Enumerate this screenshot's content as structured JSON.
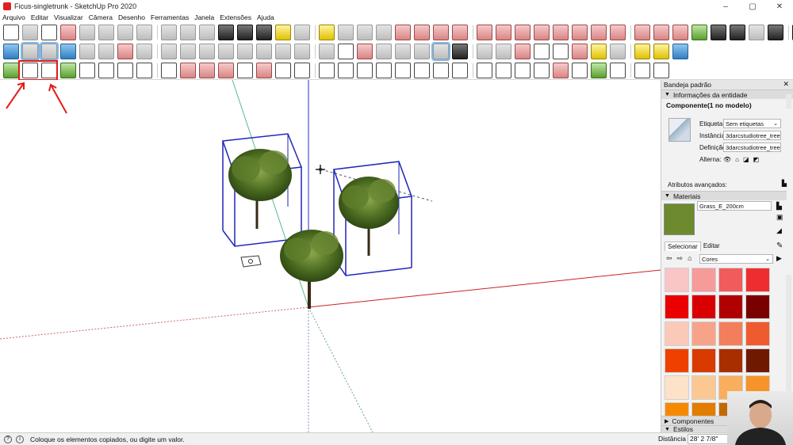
{
  "window": {
    "title": "Ficus-singletrunk - SketchUp Pro 2020",
    "controls": [
      "–",
      "▢",
      "✕"
    ]
  },
  "menu": [
    "Arquivo",
    "Editar",
    "Visualizar",
    "Câmera",
    "Desenho",
    "Ferramentas",
    "Janela",
    "Extensões",
    "Ajuda"
  ],
  "toolbars": {
    "row1": [
      "select-arrow-icon",
      "eraser-icon",
      "paint-bucket-icon",
      "eraser-pink-icon",
      "orbit-icon",
      "pan-icon",
      "zoom-icon",
      "zoom-window-icon",
      "zoom-extents-icon",
      "zoom-previous-icon",
      "position-camera-icon",
      "walk-icon",
      "look-around-icon",
      "footprints-icon",
      "tape-measure-icon",
      "dimension-icon",
      "protractor-icon",
      "text-icon",
      "axes-icon",
      "3d-text-icon",
      "move-icon",
      "rotate-icon",
      "follow-me-icon",
      "scale-icon",
      "offset-icon",
      "line-icon",
      "freehand-icon",
      "rectangle-icon",
      "rotated-rectangle-icon",
      "circle-icon",
      "polygon-icon",
      "arc-icon",
      "two-point-arc-icon",
      "three-point-arc-icon",
      "pie-icon",
      "sandbox-icon",
      "play-icon",
      "stop-icon",
      "scene-icon",
      "record-icon",
      "settings-gear-icon"
    ],
    "row2": [
      "cube-blue-icon",
      "solid-tools-icon",
      "outer-shell-icon",
      "warehouse-icon",
      "building-icon",
      "home-icon",
      "home-outline-icon",
      "model-info-icon",
      "layer-icon",
      "iso-view-icon",
      "top-view-icon",
      "front-view-icon",
      "right-view-icon",
      "back-view-icon",
      "left-view-icon",
      "xray-icon",
      "back-edges-icon",
      "wireframe-icon",
      "hidden-line-icon",
      "shaded-icon",
      "shaded-textures-icon",
      "monochrome-icon",
      "section-plane-icon",
      "section-display-icon",
      "section-cut-icon",
      "section-fill-icon",
      "red-grid-icon",
      "box-icon",
      "square-icon",
      "square-outline-icon",
      "cube-orange-icon",
      "cube-purple-icon",
      "cube-yellow-icon",
      "cube-yellow2-icon",
      "logo-blue-icon"
    ],
    "row3": [
      "sandbox-from-contours-icon",
      "make-component-icon",
      "make-group-icon",
      "grass-icon",
      "pattern-icon",
      "grid-icon",
      "sphere-icon",
      "intersect-icon",
      "edit-icon",
      "cube-outline-icon",
      "cube-outline2-icon",
      "cube-outline3-icon",
      "ring-icon",
      "circle-outline-icon",
      "hand-cursor-icon",
      "check-icon",
      "palette-icon",
      "teapot-icon",
      "smoothing-icon",
      "curve-icon",
      "refresh-icon",
      "bucket-icon",
      "frame-icon",
      "frame2-icon",
      "frame3-icon",
      "lock-icon",
      "house-sun-icon",
      "arrow-down-icon",
      "half-circle-icon",
      "triangle-icon",
      "tree-icon",
      "star-icon",
      "dome-icon",
      "disc-icon"
    ]
  },
  "viewport": {
    "axis_colors": {
      "red": "#cc2222",
      "green": "#1a9a5a",
      "blue": "#2b2bd9"
    },
    "bbox_color": "#1f26b8"
  },
  "panel": {
    "title": "Bandeja padrão",
    "entity_section": "Informações da entidade",
    "entity_name": "Componente(1 no modelo)",
    "tag_label": "Etiqueta:",
    "tag_value": "Sem etiquetas",
    "instance_label": "Instância:",
    "instance_value": "3darcstudiotree_tree10",
    "definition_label": "Definição:",
    "definition_value": "3darcstudiotree_tree00",
    "toggles_label": "Alterna:",
    "advanced_label": "Atributos avançados:",
    "materials_section": "Materiais",
    "material_name": "Grass_E_200cm",
    "material_color": "#6d8a2e",
    "tab_select": "Selecionar",
    "tab_edit": "Editar",
    "library_value": "Cores",
    "swatches": [
      "#f9c5c5",
      "#f69a9a",
      "#f15b5b",
      "#ee2e2e",
      "#ea0000",
      "#d80000",
      "#b00000",
      "#7a0000",
      "#fbc9b8",
      "#f7a38a",
      "#f37e5c",
      "#ef5a2e",
      "#f04000",
      "#d83a00",
      "#a82e00",
      "#6f1a00",
      "#fde2c8",
      "#fbc893",
      "#f9ae5e",
      "#f79429",
      "#f58a00",
      "#e27d00",
      "#c26900",
      "#8a4a00"
    ],
    "components_section": "Componentes",
    "styles_section": "Estilos"
  },
  "status": {
    "message": "Coloque os elementos copiados, ou digite um valor.",
    "distance_label": "Distância",
    "distance_value": "28' 2 7/8\""
  }
}
